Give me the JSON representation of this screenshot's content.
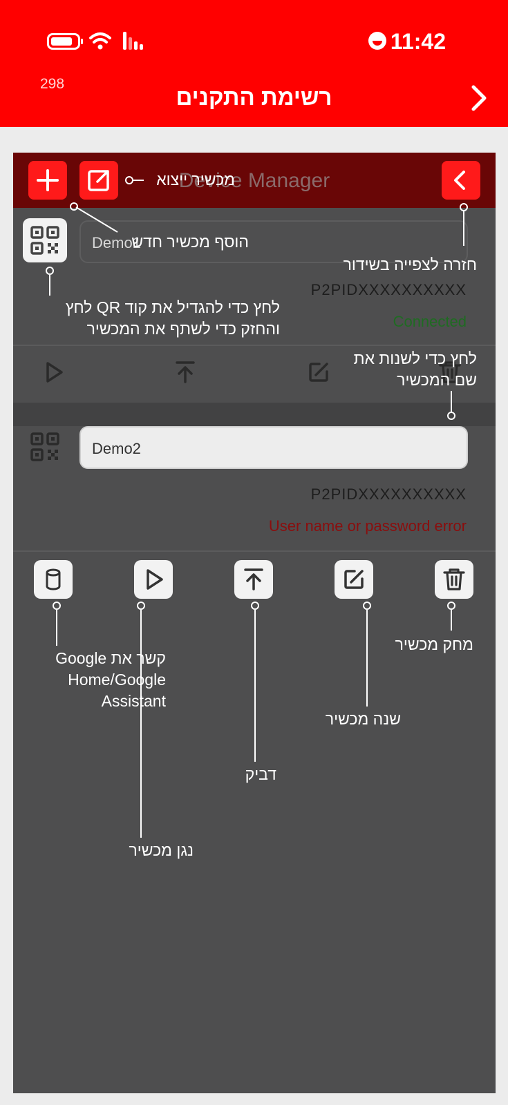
{
  "status_bar": {
    "time": "11:42"
  },
  "header": {
    "counter": "298",
    "title": "רשימת התקנים"
  },
  "panel": {
    "title": "Device Manager"
  },
  "devices": [
    {
      "name": "Demo1",
      "pid": "P2PIDXXXXXXXXXX",
      "state": "Connected",
      "state_color": "#1f6b22"
    },
    {
      "name": "Demo2",
      "pid": "P2PIDXXXXXXXXXX",
      "state": "User name or password error",
      "state_color": "#8a0e0e"
    }
  ],
  "annotations": {
    "exit_device": "מכשיר ייצוא",
    "add_device": "הוסף מכשיר חדש",
    "back_to_broadcast": "חזרה לצפייה בשידור",
    "qr_hint": "לחץ כדי להגדיל את קוד QR לחץ והחזק כדי לשתף את המכשיר",
    "rename_hint": "לחץ כדי לשנות את שם המכשיר",
    "google_link": "קשר את Google Home/Google Assistant",
    "delete_device": "מחק מכשיר",
    "change_device": "שנה מכשיר",
    "stick": "דביק",
    "play_device": "נגן מכשיר"
  },
  "colors": {
    "brand": "#ff0000",
    "panel": "#4e4e4f",
    "panel_bar": "#690606"
  },
  "icons": [
    "battery-icon",
    "wifi-icon",
    "signal-icon",
    "chevron-right-icon",
    "plus-icon",
    "export-icon",
    "back-icon",
    "qr-code-icon",
    "play-icon",
    "pin-top-icon",
    "edit-icon",
    "trash-icon",
    "speaker-icon"
  ]
}
